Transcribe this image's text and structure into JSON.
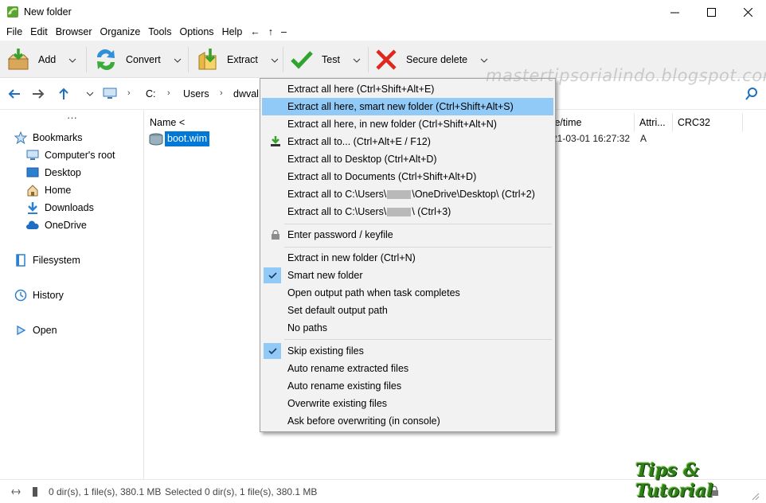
{
  "window": {
    "title": "New folder"
  },
  "menubar": [
    "File",
    "Edit",
    "Browser",
    "Organize",
    "Tools",
    "Options",
    "Help",
    "←",
    "↑",
    "–"
  ],
  "toolbar": {
    "add": "Add",
    "convert": "Convert",
    "extract": "Extract",
    "test": "Test",
    "secure_delete": "Secure delete"
  },
  "address": {
    "crumbs": [
      "C:",
      "Users",
      "dwval"
    ]
  },
  "sidebar": {
    "more": "···",
    "bookmarks": "Bookmarks",
    "items": [
      "Computer's root",
      "Desktop",
      "Home",
      "Downloads",
      "OneDrive"
    ],
    "filesystem": "Filesystem",
    "history": "History",
    "open": "Open"
  },
  "filelist": {
    "columns": {
      "name": "Name <",
      "datetime": "te/time",
      "attr": "Attri...",
      "crc": "CRC32"
    },
    "rows": [
      {
        "name": "boot.wim",
        "datetime": "21-03-01 16:27:32",
        "attr": "A"
      }
    ]
  },
  "status": {
    "left": "0 dir(s), 1 file(s), 380.1 MB",
    "selected": "Selected 0 dir(s), 1 file(s), 380.1 MB"
  },
  "context_menu": {
    "i1": "Extract all here (Ctrl+Shift+Alt+E)",
    "i2": "Extract all here, smart new folder (Ctrl+Shift+Alt+S)",
    "i3": "Extract all here, in new folder (Ctrl+Shift+Alt+N)",
    "i4": "Extract all to... (Ctrl+Alt+E / F12)",
    "i5": "Extract all to Desktop (Ctrl+Alt+D)",
    "i6": "Extract all to Documents (Ctrl+Shift+Alt+D)",
    "i7a": "Extract all to C:\\Users\\",
    "i7b": "\\OneDrive\\Desktop\\ (Ctrl+2)",
    "i8a": "Extract all to C:\\Users\\",
    "i8b": "\\ (Ctrl+3)",
    "i9": "Enter password / keyfile",
    "i10": "Extract in new folder (Ctrl+N)",
    "i11": "Smart new folder",
    "i12": "Open output path when task completes",
    "i13": "Set default output path",
    "i14": "No paths",
    "i15": "Skip existing files",
    "i16": "Auto rename extracted files",
    "i17": "Auto rename existing files",
    "i18": "Overwrite existing files",
    "i19": "Ask before overwriting (in console)"
  },
  "watermark": "mastertipsorialindo.blogspot.com",
  "logo": "Tips & Tutorial",
  "colors": {
    "highlight": "#91c9f7",
    "selection": "#0078d7",
    "accent": "#1e6fc4"
  }
}
